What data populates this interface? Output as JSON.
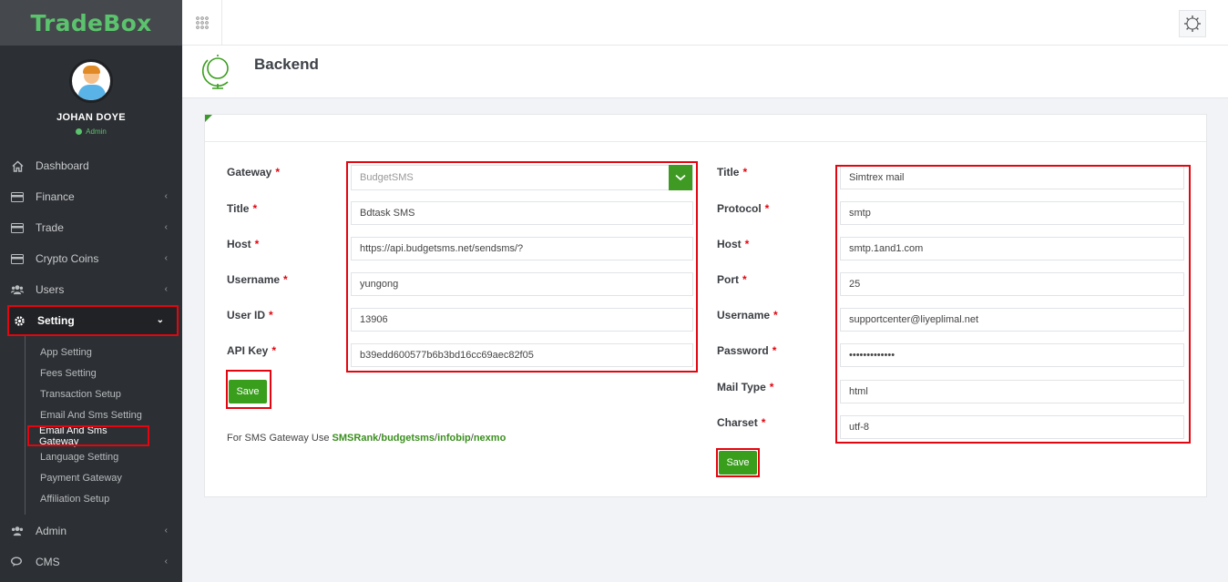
{
  "brand": {
    "name": "TradeBox"
  },
  "user": {
    "name": "JOHAN DOYE",
    "role": "Admin"
  },
  "sidebar": {
    "items": [
      {
        "label": "Dashboard",
        "icon": "home-icon"
      },
      {
        "label": "Finance",
        "icon": "card-icon"
      },
      {
        "label": "Trade",
        "icon": "card-icon"
      },
      {
        "label": "Crypto Coins",
        "icon": "card-icon"
      },
      {
        "label": "Users",
        "icon": "users-icon"
      },
      {
        "label": "Setting",
        "icon": "gear-icon",
        "expanded": true
      }
    ],
    "subitems": [
      "App Setting",
      "Fees Setting",
      "Transaction Setup",
      "Email And Sms Setting",
      "Email And Sms Gateway",
      "Language Setting",
      "Payment Gateway",
      "Affiliation Setup"
    ],
    "active_subitem": "Email And Sms Gateway",
    "bottom_items": [
      {
        "label": "Admin",
        "icon": "users-icon"
      },
      {
        "label": "CMS",
        "icon": "chat-icon"
      }
    ]
  },
  "page": {
    "title": "Backend"
  },
  "sms_form": {
    "gateway": {
      "label": "Gateway",
      "value": "BudgetSMS"
    },
    "title": {
      "label": "Title",
      "value": "Bdtask SMS"
    },
    "host": {
      "label": "Host",
      "value": "https://api.budgetsms.net/sendsms/?"
    },
    "username": {
      "label": "Username",
      "value": "yungong"
    },
    "user_id": {
      "label": "User ID",
      "value": "13906"
    },
    "api_key": {
      "label": "API Key",
      "value": "b39edd600577b6b3bd16cc69aec82f05"
    },
    "save_label": "Save",
    "note_prefix": "For SMS Gateway Use ",
    "links": [
      "SMSRank",
      "budgetsms",
      "infobip",
      "nexmo"
    ],
    "separator": "/"
  },
  "email_form": {
    "title": {
      "label": "Title",
      "value": "Simtrex mail"
    },
    "protocol": {
      "label": "Protocol",
      "value": "smtp"
    },
    "host": {
      "label": "Host",
      "value": "smtp.1and1.com"
    },
    "port": {
      "label": "Port",
      "value": "25"
    },
    "username": {
      "label": "Username",
      "value": "supportcenter@liyeplimal.net"
    },
    "password": {
      "label": "Password",
      "value": "•••••••••••••"
    },
    "mail_type": {
      "label": "Mail Type",
      "value": "html"
    },
    "charset": {
      "label": "Charset",
      "value": "utf-8"
    },
    "save_label": "Save"
  },
  "required_mark": "*",
  "colors": {
    "accent": "#3a9e1d",
    "brand": "#5bc26d",
    "highlight": "#e3050f",
    "sidebar": "#2c2f33"
  }
}
